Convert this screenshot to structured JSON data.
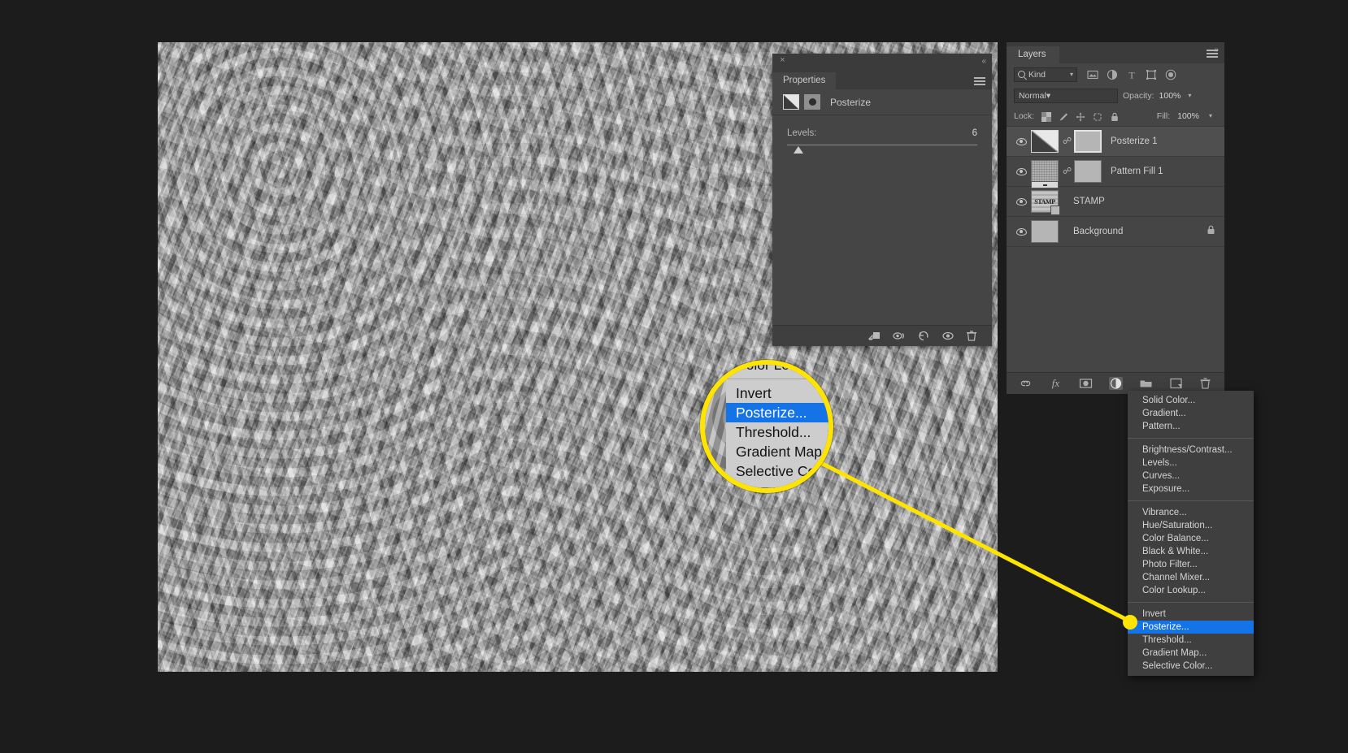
{
  "app": {
    "background_color": "#1c1c1c",
    "accent_color": "#1473e6",
    "highlight_color": "#ffe400"
  },
  "canvas": {
    "name": "document-canvas",
    "description": "Gray posterized noise pattern texture"
  },
  "properties_panel": {
    "tab_label": "Properties",
    "close_label": "×",
    "collapse_label": "«",
    "adjustment_icon": "posterize-adjustment-icon",
    "mask_icon": "layer-mask-icon",
    "title": "Posterize",
    "levels_label": "Levels:",
    "levels_value": "6",
    "footer_icons": [
      "clip-to-layer-icon",
      "view-previous-state-icon",
      "reset-adjustment-icon",
      "toggle-visibility-icon",
      "delete-adjustment-icon"
    ]
  },
  "layers_panel": {
    "tab_label": "Layers",
    "close_label": "×",
    "collapse_label": "»",
    "filter": {
      "kind_label": "Kind",
      "search_icon": "search-icon",
      "icons": [
        "filter-pixel-layers-icon",
        "filter-adjustment-layers-icon",
        "filter-type-layers-icon",
        "filter-shape-layers-icon",
        "filter-smart-object-icon"
      ]
    },
    "blend_mode": "Normal",
    "opacity_label": "Opacity:",
    "opacity_value": "100%",
    "lock_label": "Lock:",
    "lock_icons": [
      "lock-transparent-pixels-icon",
      "lock-image-pixels-icon",
      "lock-position-icon",
      "lock-artboard-nesting-icon",
      "lock-all-icon"
    ],
    "fill_label": "Fill:",
    "fill_value": "100%",
    "layers": [
      {
        "name": "Posterize 1",
        "visible": true,
        "thumb_kind": "adjustment",
        "linked": true,
        "has_mask": true,
        "mask_active": true,
        "selected": true,
        "locked": false
      },
      {
        "name": "Pattern Fill 1",
        "visible": true,
        "thumb_kind": "pattern",
        "linked": true,
        "has_mask": true,
        "mask_active": false,
        "selected": false,
        "locked": false
      },
      {
        "name": "STAMP",
        "visible": true,
        "thumb_kind": "stamp",
        "thumb_text": "STAMP",
        "linked": false,
        "has_mask": false,
        "selected": false,
        "locked": false
      },
      {
        "name": "Background",
        "visible": true,
        "thumb_kind": "plain",
        "linked": false,
        "has_mask": false,
        "selected": false,
        "locked": true
      }
    ],
    "footer_icons": [
      "link-layers-icon",
      "layer-style-fx-icon",
      "add-layer-mask-icon",
      "new-adjustment-layer-icon",
      "new-group-icon",
      "new-layer-icon",
      "delete-layer-icon"
    ]
  },
  "adjustment_menu": {
    "name": "new-adjustment-layer-menu",
    "groups": [
      [
        "Solid Color...",
        "Gradient...",
        "Pattern..."
      ],
      [
        "Brightness/Contrast...",
        "Levels...",
        "Curves...",
        "Exposure..."
      ],
      [
        "Vibrance...",
        "Hue/Saturation...",
        "Color Balance...",
        "Black & White...",
        "Photo Filter...",
        "Channel Mixer...",
        "Color Lookup..."
      ],
      [
        "Invert",
        "Posterize...",
        "Threshold...",
        "Gradient Map...",
        "Selective Color..."
      ]
    ],
    "highlighted": "Posterize..."
  },
  "magnifier": {
    "name": "magnifier-callout",
    "items": [
      "Color Lookup...",
      "Invert",
      "Posterize...",
      "Threshold...",
      "Gradient Map...",
      "Selective Color..."
    ],
    "highlighted": "Posterize...",
    "ring_color": "#ffe400"
  }
}
